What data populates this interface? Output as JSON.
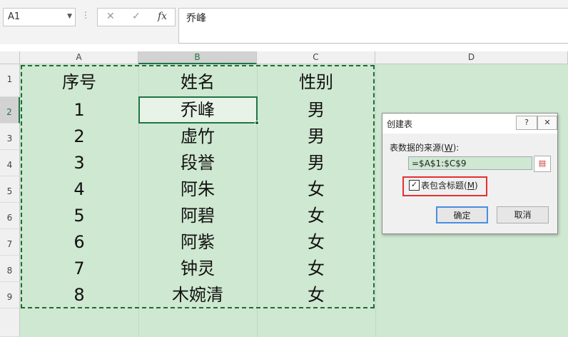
{
  "namebox": {
    "value": "A1"
  },
  "formula_bar": {
    "cancel_glyph": "✕",
    "enter_glyph": "✓",
    "fx_label": "fx",
    "value": "乔峰"
  },
  "columns": [
    "A",
    "B",
    "C",
    "D"
  ],
  "rows": [
    "1",
    "2",
    "3",
    "4",
    "5",
    "6",
    "7",
    "8",
    "9"
  ],
  "table": {
    "headers": [
      "序号",
      "姓名",
      "性别"
    ],
    "data": [
      [
        "1",
        "乔峰",
        "男"
      ],
      [
        "2",
        "虚竹",
        "男"
      ],
      [
        "3",
        "段誉",
        "男"
      ],
      [
        "4",
        "阿朱",
        "女"
      ],
      [
        "5",
        "阿碧",
        "女"
      ],
      [
        "6",
        "阿紫",
        "女"
      ],
      [
        "7",
        "钟灵",
        "女"
      ],
      [
        "8",
        "木婉清",
        "女"
      ]
    ]
  },
  "dialog": {
    "title": "创建表",
    "help_label": "?",
    "close_label": "✕",
    "source_label": "表数据的来源(",
    "source_key": "W",
    "source_suffix": "):",
    "range_value": "=$A$1:$C$9",
    "checkbox_mark": "✓",
    "checkbox_label": "表包含标题(",
    "checkbox_key": "M",
    "checkbox_suffix": ")",
    "ok_label": "确定",
    "cancel_label": "取消"
  },
  "colors": {
    "grid_fill": "#cfe8d1",
    "excel_green": "#217346",
    "highlight_red": "#e53030"
  }
}
